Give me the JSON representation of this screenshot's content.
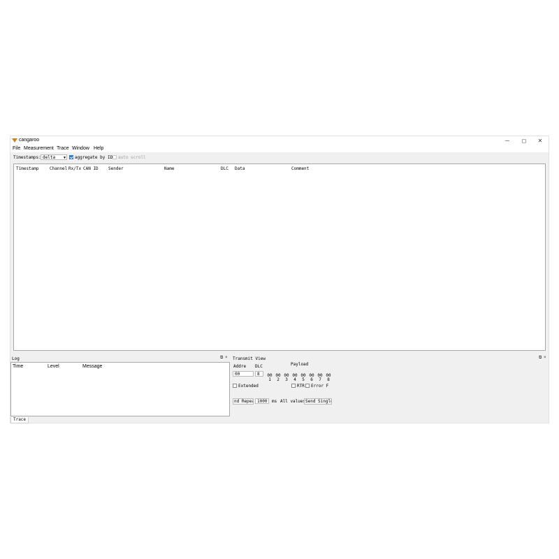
{
  "window": {
    "title": "cangaroo",
    "minimize": "─",
    "maximize": "◻",
    "close": "✕"
  },
  "menu": [
    "File",
    "Measurement",
    "Trace",
    "Window",
    "Help"
  ],
  "toolbar": {
    "timestamps_label": "Timestamps:",
    "timestamps_value": "delta",
    "aggregate_label": "aggregate by ID",
    "aggregate_checked": true,
    "autoscroll_label": "auto scroll",
    "autoscroll_checked": false
  },
  "trace": {
    "columns": [
      "Timestamp",
      "Channel",
      "Rx/Tx",
      "CAN ID",
      "Sender",
      "Name",
      "DLC",
      "Data",
      "Comment"
    ]
  },
  "log": {
    "title": "Log",
    "columns": [
      "Time",
      "Level",
      "Message"
    ]
  },
  "transmit": {
    "title": "Transmit View",
    "address_label": "Addre",
    "dlc_label": "DLC",
    "payload_label": "Payload",
    "address_value": "00",
    "dlc_value": "8",
    "bytes": [
      "00",
      "00",
      "00",
      "00",
      "00",
      "00",
      "00",
      "00"
    ],
    "byte_indices": [
      "1",
      "2",
      "3",
      "4",
      "5",
      "6",
      "7",
      "8"
    ],
    "extended_label": "Extended",
    "rtr_label": "RTR",
    "error_label": "Error F",
    "repeat_label": "nd Repea",
    "repeat_value": "1000",
    "ms_label": "ms",
    "all_values_label": "All values",
    "send_single_label": "Send Single"
  },
  "tabs": [
    "Trace"
  ],
  "colors": {
    "accent": "#2a7bd1",
    "window_bg": "#f0f0f0",
    "border": "#a8a8a8"
  }
}
